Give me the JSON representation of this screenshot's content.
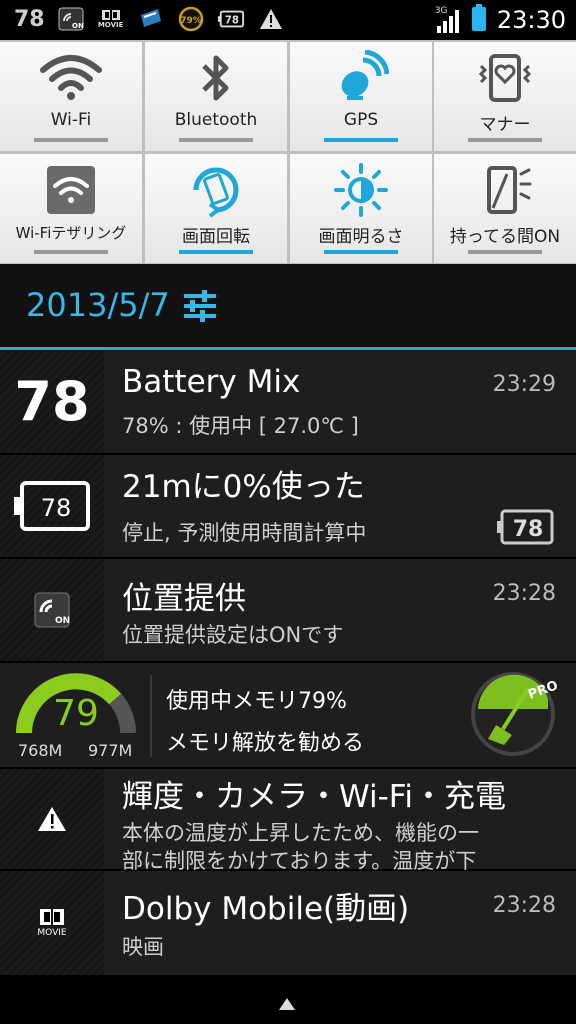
{
  "statusbar": {
    "battery_level": "78",
    "icons": [
      "location-on-icon",
      "dolby-movie-icon",
      "memory-cleaner-icon",
      "memory-79-icon",
      "battery-78-icon",
      "warning-icon"
    ],
    "movie_label": "MOVIE",
    "memory_label": "79%",
    "battery_small": "78",
    "network": "3G",
    "time": "23:30"
  },
  "quick_settings": [
    {
      "label": "Wi-Fi",
      "icon": "wifi-icon",
      "active": false
    },
    {
      "label": "Bluetooth",
      "icon": "bluetooth-icon",
      "active": false
    },
    {
      "label": "GPS",
      "icon": "gps-icon",
      "active": true
    },
    {
      "label": "マナー",
      "icon": "manner-mode-icon",
      "active": false
    },
    {
      "label": "Wi-Fiテザリング",
      "icon": "wifi-tethering-icon",
      "active": false
    },
    {
      "label": "画面回転",
      "icon": "screen-rotation-icon",
      "active": true
    },
    {
      "label": "画面明るさ",
      "icon": "brightness-icon",
      "active": true
    },
    {
      "label": "持ってる間ON",
      "icon": "hold-on-icon",
      "active": false
    }
  ],
  "date": "2013/5/7",
  "notifications": [
    {
      "name": "battery-mix",
      "title": "Battery Mix",
      "text": "78% : 使用中 [ 27.0℃ ]",
      "time": "23:29",
      "icon_text": "78"
    },
    {
      "name": "battery-usage",
      "title": "21mに0%使った",
      "text": "停止, 予測使用時間計算中",
      "time": "",
      "icon_text": "78",
      "badge": "78"
    },
    {
      "name": "location",
      "title": "位置提供",
      "text": "位置提供設定はONです",
      "time": "23:28",
      "icon_text": "ON"
    },
    {
      "name": "memory",
      "gauge_value": "79",
      "gauge_min": "768M",
      "gauge_max": "977M",
      "line1": "使用中メモリ79%",
      "line2": "メモリ解放を勧める",
      "badge": "PRO"
    },
    {
      "name": "temperature-warning",
      "title": "輝度・カメラ・Wi-Fi・充電",
      "text": "本体の温度が上昇したため、機能の一",
      "text2": "部に制限をかけております。温度が下"
    },
    {
      "name": "dolby",
      "title": "Dolby Mobile(動画)",
      "text": "映画",
      "time": "23:28",
      "icon_text": "MOVIE"
    }
  ],
  "colors": {
    "accent": "#2aa7d8",
    "gauge": "#8ccc1e",
    "background": "#1e1e1e"
  }
}
